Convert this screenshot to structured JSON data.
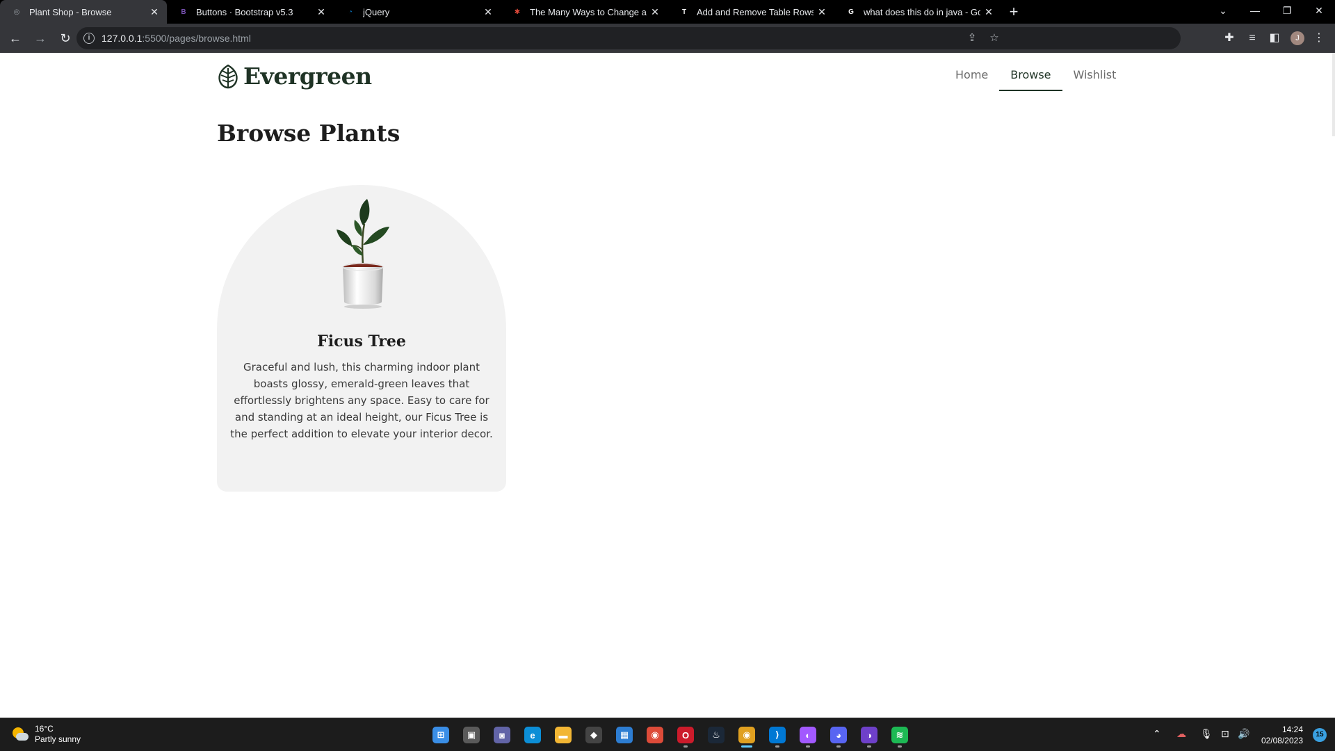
{
  "browser": {
    "tabs": [
      {
        "title": "Plant Shop - Browse",
        "active": true,
        "favicon": "globe-icon",
        "favicon_char": "◎",
        "favicon_color": "#9aa0a6"
      },
      {
        "title": "Buttons · Bootstrap v5.3",
        "active": false,
        "favicon": "bootstrap-icon",
        "favicon_char": "B",
        "favicon_color": "#7952b3"
      },
      {
        "title": "jQuery",
        "active": false,
        "favicon": "jquery-icon",
        "favicon_char": "◔",
        "favicon_color": "#0769ad"
      },
      {
        "title": "The Many Ways to Change an SV",
        "active": false,
        "favicon": "csstricks-icon",
        "favicon_char": "✱",
        "favicon_color": "#e74c3c"
      },
      {
        "title": "Add and Remove Table Rows Dy",
        "active": false,
        "favicon": "tutorial-icon",
        "favicon_char": "T",
        "favicon_color": "#f1f1f1"
      },
      {
        "title": "what does this do in java - Goog",
        "active": false,
        "favicon": "google-icon",
        "favicon_char": "G",
        "favicon_color": "#ffffff"
      }
    ],
    "new_tab": "+",
    "address": {
      "host": "127.0.0.1",
      "rest": ":5500/pages/browse.html"
    },
    "profile_initial": "J"
  },
  "site": {
    "brand": "Evergreen",
    "nav": [
      {
        "label": "Home",
        "active": false
      },
      {
        "label": "Browse",
        "active": true
      },
      {
        "label": "Wishlist",
        "active": false
      }
    ],
    "page_title": "Browse Plants",
    "products": [
      {
        "name": "Ficus Tree",
        "description": "Graceful and lush, this charming indoor plant boasts glossy, emerald-green leaves that effortlessly brightens any space. Easy to care for and standing at an ideal height, our Ficus Tree is the perfect addition to elevate your interior decor."
      }
    ]
  },
  "taskbar": {
    "weather": {
      "temp": "16°C",
      "condition": "Partly sunny"
    },
    "apps": [
      {
        "name": "windows-start-icon",
        "char": "⊞",
        "color": "#3a8ee6",
        "active": false,
        "running": false
      },
      {
        "name": "task-view-icon",
        "char": "▣",
        "color": "#5a5a5a",
        "active": false,
        "running": false
      },
      {
        "name": "teams-chat-icon",
        "char": "◙",
        "color": "#6264a7",
        "active": false,
        "running": false
      },
      {
        "name": "edge-icon",
        "char": "e",
        "color": "#0c8ed6",
        "active": false,
        "running": false
      },
      {
        "name": "file-explorer-icon",
        "char": "▬",
        "color": "#f2b634",
        "active": false,
        "running": false
      },
      {
        "name": "unity-icon",
        "char": "◆",
        "color": "#444",
        "active": false,
        "running": false
      },
      {
        "name": "store-icon",
        "char": "▦",
        "color": "#2d7dd2",
        "active": false,
        "running": false
      },
      {
        "name": "chrome-icon",
        "char": "◉",
        "color": "#dd4b39",
        "active": false,
        "running": false
      },
      {
        "name": "opera-icon",
        "char": "O",
        "color": "#cc1b2b",
        "active": false,
        "running": true
      },
      {
        "name": "steam-icon",
        "char": "♨",
        "color": "#1b2838",
        "active": false,
        "running": false
      },
      {
        "name": "chrome-dev-icon",
        "char": "◉",
        "color": "#e0a020",
        "active": true,
        "running": true
      },
      {
        "name": "vscode-icon",
        "char": "⟩",
        "color": "#0078d4",
        "active": false,
        "running": true
      },
      {
        "name": "figma-icon",
        "char": "◐",
        "color": "#a259ff",
        "active": false,
        "running": true
      },
      {
        "name": "discord-icon",
        "char": "◕",
        "color": "#5865f2",
        "active": false,
        "running": true
      },
      {
        "name": "github-desktop-icon",
        "char": "◑",
        "color": "#6e40c9",
        "active": false,
        "running": true
      },
      {
        "name": "spotify-icon",
        "char": "≋",
        "color": "#1db954",
        "active": false,
        "running": true
      }
    ],
    "time": "14:24",
    "date": "02/08/2023",
    "notification_count": "15"
  }
}
